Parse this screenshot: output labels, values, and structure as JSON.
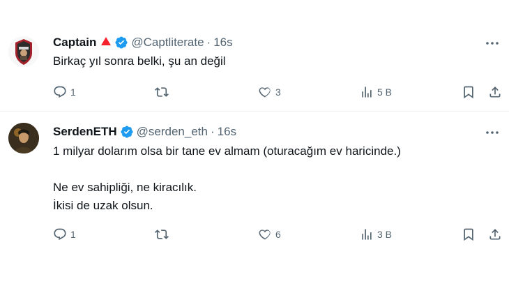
{
  "tweets": [
    {
      "name": "Captain",
      "handle": "@Captliterate",
      "separator": "·",
      "time": "16s",
      "lines": [
        "Birkaç yıl sonra belki, şu an değil"
      ],
      "replies": "1",
      "retweets": "",
      "likes": "3",
      "views": "5 B",
      "icons": [
        "red-triangle-badge",
        "verified-badge"
      ]
    },
    {
      "name": "SerdenETH",
      "handle": "@serden_eth",
      "separator": "·",
      "time": "16s",
      "lines": [
        "1 milyar dolarım olsa bir tane ev almam (oturacağım ev haricinde.)",
        "",
        "Ne ev sahipliği, ne kiracılık.",
        "İkisi de uzak olsun."
      ],
      "replies": "1",
      "retweets": "",
      "likes": "6",
      "views": "3 B",
      "icons": [
        "verified-badge"
      ]
    }
  ],
  "colors": {
    "text": "#0f1419",
    "secondary": "#536471",
    "verified": "#1d9bf0",
    "badge_red": "#f4212e",
    "divider": "#eff3f4"
  }
}
